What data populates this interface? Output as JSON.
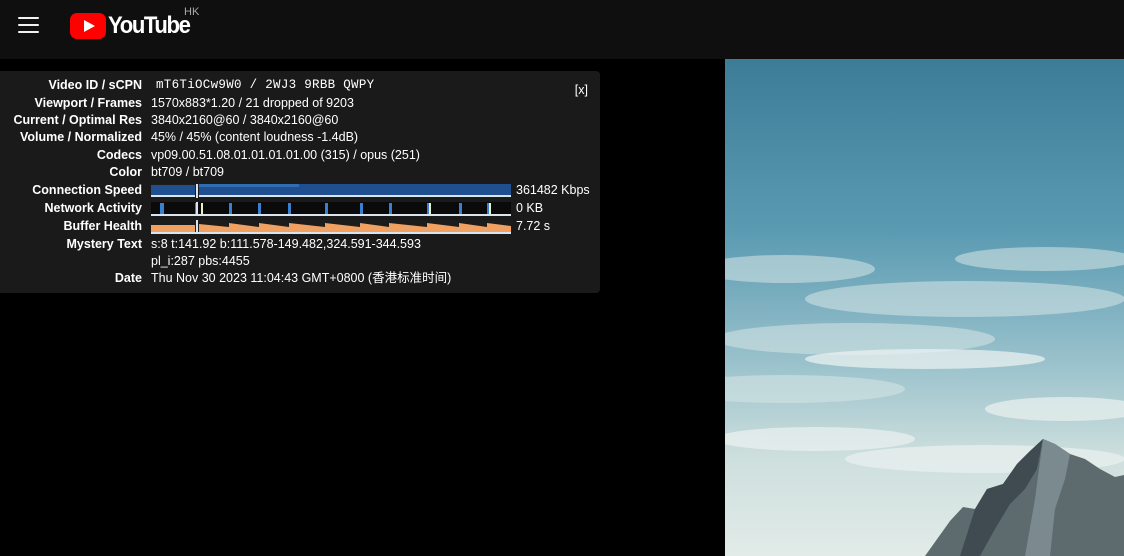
{
  "header": {
    "logo_text": "YouTube",
    "country_code": "HK"
  },
  "stats": {
    "close_label": "[x]",
    "rows": [
      {
        "label": "Video ID / sCPN",
        "value": "mT6TiOCw9W0 / 2WJ3 9RBB QWPY"
      },
      {
        "label": "Viewport / Frames",
        "value": "1570x883*1.20 / 21 dropped of 9203"
      },
      {
        "label": "Current / Optimal Res",
        "value": "3840x2160@60 / 3840x2160@60"
      },
      {
        "label": "Volume / Normalized",
        "value": "45% / 45% (content loudness -1.4dB)"
      },
      {
        "label": "Codecs",
        "value": "vp09.00.51.08.01.01.01.01.00 (315) / opus (251)"
      },
      {
        "label": "Color",
        "value": "bt709 / bt709"
      },
      {
        "label": "Connection Speed",
        "value": "361482 Kbps"
      },
      {
        "label": "Network Activity",
        "value": "0 KB"
      },
      {
        "label": "Buffer Health",
        "value": "7.72 s"
      },
      {
        "label": "Mystery Text",
        "value": "s:8 t:141.92 b:111.578-149.482,324.591-344.593",
        "value2": "pl_i:287 pbs:4455"
      },
      {
        "label": "Date",
        "value": "Thu Nov 30 2023 11:04:43 GMT+0800 (香港标准时间)"
      }
    ]
  },
  "colors": {
    "connection_graph": "#1f4f8f",
    "network_graph": "#3a7fd0",
    "buffer_graph": "#f0a060"
  }
}
